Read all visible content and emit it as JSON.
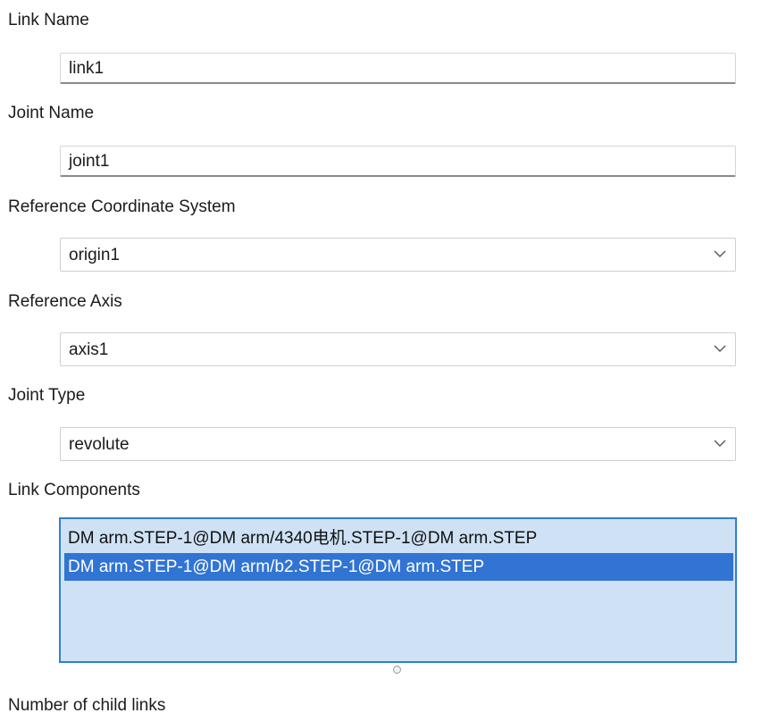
{
  "form": {
    "link_name": {
      "label": "Link Name",
      "value": "link1"
    },
    "joint_name": {
      "label": "Joint Name",
      "value": "joint1"
    },
    "reference_coordinate_system": {
      "label": "Reference Coordinate System",
      "selected": "origin1"
    },
    "reference_axis": {
      "label": "Reference Axis",
      "selected": "axis1"
    },
    "joint_type": {
      "label": "Joint Type",
      "selected": "revolute"
    },
    "link_components": {
      "label": "Link Components",
      "items": [
        {
          "text": "DM arm.STEP-1@DM arm/4340电机.STEP-1@DM arm.STEP",
          "selected": false
        },
        {
          "text": "DM arm.STEP-1@DM arm/b2.STEP-1@DM arm.STEP",
          "selected": true
        }
      ]
    },
    "number_of_child_links": {
      "label": "Number of child links"
    }
  },
  "icons": {
    "dropdown": "chevron-down-icon",
    "resize": "resize-grip-icon"
  },
  "colors": {
    "list_background": "#cfe2f5",
    "list_border": "#2d80d2",
    "selection": "#3174d3"
  }
}
